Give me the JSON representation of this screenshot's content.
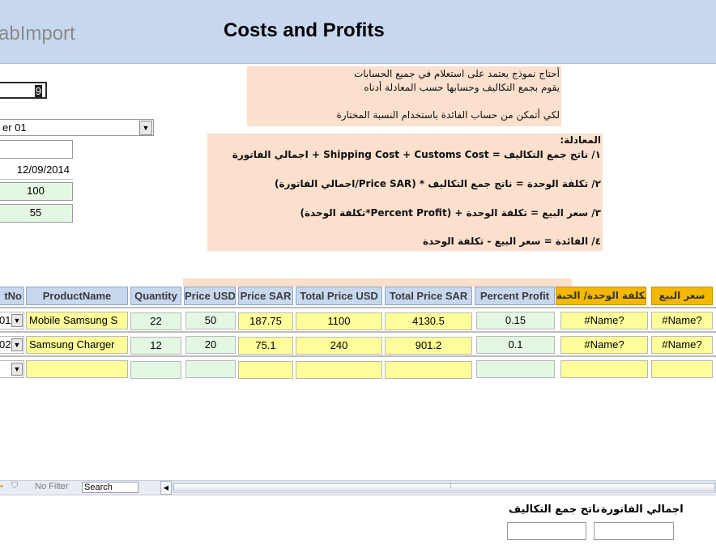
{
  "header": {
    "app_title": "abImport",
    "form_title": "Costs and Profits"
  },
  "fields": {
    "id_value": "9",
    "combo_value": "er 01",
    "empty_value": "",
    "date_value": "12/09/2014",
    "value_100": "100",
    "value_55": "55"
  },
  "note_top": [
    "أحتاج نموذج يعتمد على استعلام في جميع الحسابات",
    "يقوم بجمع التكاليف وحسابها حسب المعادلة أدناه",
    "",
    "لكي أتمكن من حساب الفائدة باستخدام النسبة المختارة"
  ],
  "equations": {
    "heading": "المعادلة:",
    "eq1": "١/ ناتج جمع التكاليف  =  Shipping Cost + Customs Cost + اجمالي الفاتورة",
    "eq2": "٢/ تكلفة الوحدة = ناتج جمع التكاليف * (Price SAR/اجمالي الفاتورة)",
    "eq3": "٣/ سعر البيع          =  تكلفة الوحدة + (Percent Profit*تكلفة الوحدة)",
    "eq4": "٤/ الفائدة              = سعر البيع - تكلفة الوحدة"
  },
  "grid": {
    "headers": {
      "c0": "tNo",
      "c1": "ProductName",
      "c2": "Quantity",
      "c3": "Price USD",
      "c4": "Price SAR",
      "c5": "Total Price USD",
      "c6": "Total Price SAR",
      "c7": "Percent Profit",
      "c8": "تكلفة الوحدة/ الحبة",
      "c9": "سعر البيع"
    },
    "rows": [
      {
        "no": "01",
        "product": "Mobile Samsung S",
        "qty": "22",
        "usd": "50",
        "sar": "187.75",
        "tusd": "1100",
        "tsar": "4130.5",
        "pp": "0.15",
        "unit": "#Name?",
        "sell": "#Name?"
      },
      {
        "no": "02",
        "product": "Samsung Charger",
        "qty": "12",
        "usd": "20",
        "sar": "75.1",
        "tusd": "240",
        "tsar": "901.2",
        "pp": "0.1",
        "unit": "#Name?",
        "sell": "#Name?"
      }
    ]
  },
  "navbar": {
    "no_filter": "No Filter",
    "search_placeholder": "Search"
  },
  "footer": {
    "label_invoice_total": "اجمالي الفاتورة",
    "label_costs_total": "ناتج جمع التكاليف"
  }
}
